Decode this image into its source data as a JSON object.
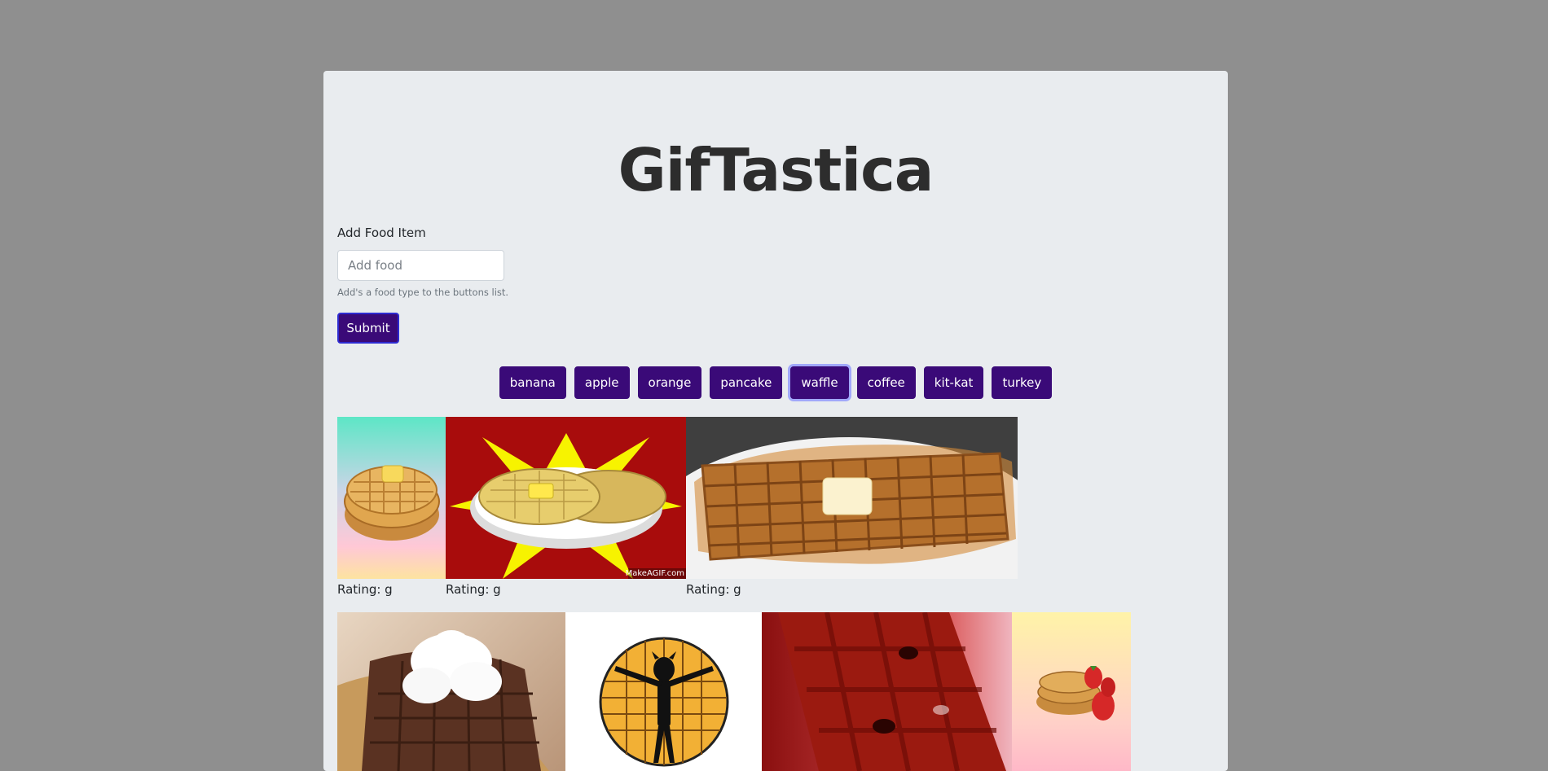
{
  "header": {
    "title": "GifTastica"
  },
  "form": {
    "label": "Add Food Item",
    "input_placeholder": "Add food",
    "input_value": "",
    "help": "Add's a food type to the buttons list.",
    "submit_label": "Submit"
  },
  "food_buttons": [
    {
      "label": "banana"
    },
    {
      "label": "apple"
    },
    {
      "label": "orange"
    },
    {
      "label": "pancake"
    },
    {
      "label": "waffle",
      "active": true
    },
    {
      "label": "coffee"
    },
    {
      "label": "kit-kat"
    },
    {
      "label": "turkey"
    }
  ],
  "gifs": [
    {
      "subject": "waffle stack with butter",
      "rating": "Rating: g"
    },
    {
      "subject": "cartoon waffles on plate",
      "rating": "Rating: g",
      "watermark": "MakeAGIF.com"
    },
    {
      "subject": "waffle with butter and syrup",
      "rating": "Rating: g"
    },
    {
      "subject": "chocolate waffle with whipped cream"
    },
    {
      "subject": "cartoon figure on waffle"
    },
    {
      "subject": "waffle with syrup"
    },
    {
      "subject": "waffles with strawberries"
    }
  ],
  "colors": {
    "background": "#8f8f8f",
    "panel": "#e9ecef",
    "button": "#3a0a78"
  }
}
